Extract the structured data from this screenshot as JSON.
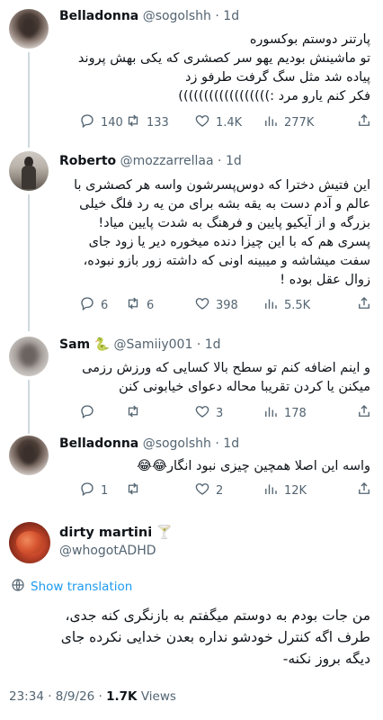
{
  "replies": [
    {
      "name": "Belladonna",
      "handle": "@sogolshh",
      "dot": "·",
      "time": "1d",
      "lines": [
        "پارتنر دوستم بوکسوره",
        "تو ماشینش بودیم یهو سر کصشری که یکی بهش پروند",
        "پیاده شد مثل سگ گرفت طرفو زد",
        "فکر کنم یارو مرد :))))))))))))))))))"
      ],
      "replies": "140",
      "retweets": "133",
      "likes": "1.4K",
      "views": "277K"
    },
    {
      "name": "Roberto",
      "handle": "@mozzarrellaa",
      "dot": "·",
      "time": "1d",
      "lines": [
        "این فتیش دخترا که دوس‌پسرشون واسه هر کصشری با",
        "عالم و آدم دست به یقه بشه برای من یه رد فلگ خیلی",
        "بزرگه و از آیکیو پایین و فرهنگ به شدت پایین میاد!",
        "پسری هم که با این چیزا دنده میخوره دیر یا زود جای",
        "سفت میشاشه و میبینه اونی که داشته زور بازو نبوده،",
        "زوال عقل بوده !"
      ],
      "replies": "6",
      "retweets": "6",
      "likes": "398",
      "views": "5.5K"
    },
    {
      "name": "Sam",
      "handle": "@Samiiy001",
      "dot": "·",
      "time": "1d",
      "lines": [
        "و اینم اضافه کنم تو سطح بالا کسایی که ورزش رزمی",
        "میکنن یا کردن تقریبا محاله دعوای خیابونی کنن"
      ],
      "replies": "",
      "retweets": "",
      "likes": "3",
      "views": "178"
    },
    {
      "name": "Belladonna",
      "handle": "@sogolshh",
      "dot": "·",
      "time": "1d",
      "lines": [
        "واسه این اصلا همچین چیزی نبود انگار😂😂"
      ],
      "replies": "1",
      "retweets": "",
      "likes": "2",
      "views": "12K"
    }
  ],
  "main_tweet": {
    "name": "dirty martini",
    "name_emoji": "🍸",
    "handle": "@whogotADHD",
    "show_translation": "Show translation",
    "lines": [
      "من جات بودم به دوستم میگفتم به بازنگری کنه جدی،",
      "طرف اگه کنترل خودشو نداره بعدن خدایی نکرده جای",
      "دیگه بروز نکنه-"
    ],
    "time": "23:34",
    "sep": "·",
    "date": "8/9/26",
    "views_count": "1.7K",
    "views_label": "Views"
  },
  "colors": {
    "text": "#0f1419",
    "secondary": "#536471",
    "link": "#1d9bf0",
    "divider": "#eff3f4",
    "thread": "#cfd9de"
  }
}
